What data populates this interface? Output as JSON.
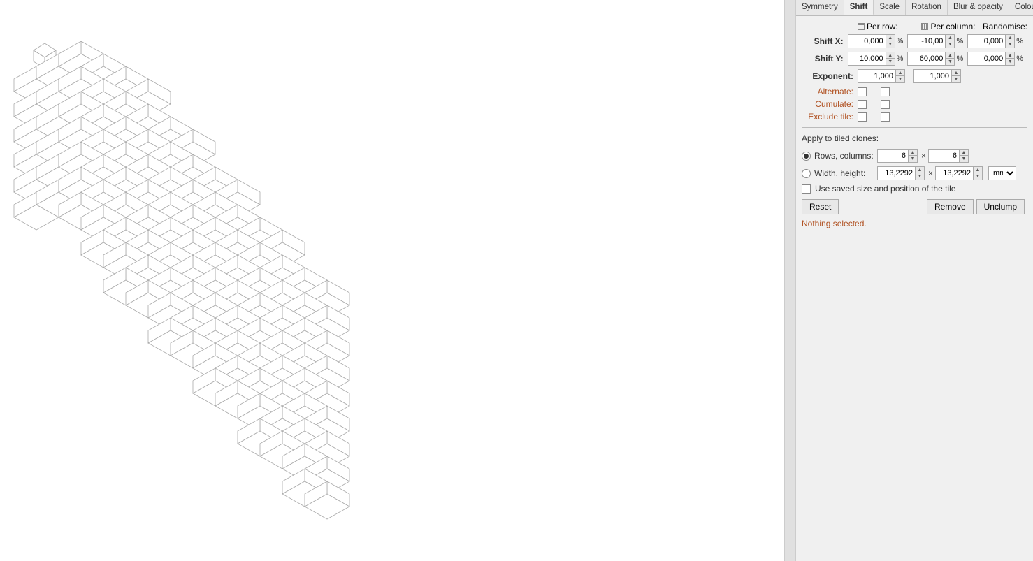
{
  "tabs": [
    {
      "id": "symmetry",
      "label": "Symmetry",
      "active": false
    },
    {
      "id": "shift",
      "label": "Shift",
      "active": true
    },
    {
      "id": "scale",
      "label": "Scale",
      "active": false
    },
    {
      "id": "rotation",
      "label": "Rotation",
      "active": false
    },
    {
      "id": "blur-opacity",
      "label": "Blur & opacity",
      "active": false
    },
    {
      "id": "colour",
      "label": "Colour",
      "active": false
    }
  ],
  "columns": {
    "per_row_label": "Per row:",
    "per_col_label": "Per column:",
    "randomise_label": "Randomise:"
  },
  "shift_x": {
    "label": "Shift X:",
    "per_row_value": "0,000",
    "per_col_value": "-10,00",
    "randomise_value": "0,000",
    "pct": "%"
  },
  "shift_y": {
    "label": "Shift Y:",
    "per_row_value": "10,000",
    "per_col_value": "60,000",
    "randomise_value": "0,000",
    "pct": "%"
  },
  "exponent": {
    "label": "Exponent:",
    "per_row_value": "1,000",
    "per_col_value": "1,000"
  },
  "alternate": {
    "label": "Alternate:",
    "per_row_checked": false,
    "per_col_checked": false
  },
  "cumulate": {
    "label": "Cumulate:",
    "per_row_checked": false,
    "per_col_checked": false
  },
  "exclude_tile": {
    "label": "Exclude tile:",
    "per_row_checked": false,
    "per_col_checked": false
  },
  "apply_section": {
    "label": "Apply to tiled clones:"
  },
  "rows_cols": {
    "label": "Rows, columns:",
    "selected": true,
    "rows_value": "6",
    "cols_value": "6"
  },
  "width_height": {
    "label": "Width, height:",
    "selected": false,
    "width_value": "13,2292",
    "height_value": "13,2292",
    "unit": "mm"
  },
  "use_saved": {
    "label": "Use saved size and position of the tile",
    "checked": false
  },
  "buttons": {
    "reset": "Reset",
    "remove": "Remove",
    "unclump": "Unclump"
  },
  "status": "Nothing selected."
}
